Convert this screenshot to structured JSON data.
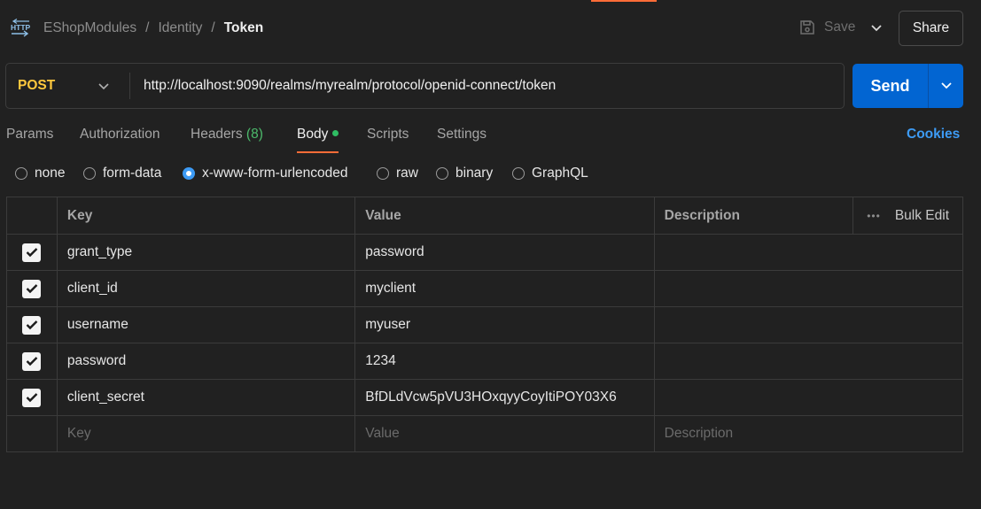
{
  "breadcrumb": {
    "workspace": "EShopModules",
    "folder": "Identity",
    "request": "Token",
    "separator": "/"
  },
  "header": {
    "save_label": "Save",
    "share_label": "Share"
  },
  "request": {
    "method": "POST",
    "url": "http://localhost:9090/realms/myrealm/protocol/openid-connect/token",
    "send_label": "Send"
  },
  "tabs": {
    "params": "Params",
    "authorization": "Authorization",
    "headers": "Headers",
    "headers_count": "(8)",
    "body": "Body",
    "scripts": "Scripts",
    "settings": "Settings",
    "cookies": "Cookies"
  },
  "body_types": {
    "options": [
      "none",
      "form-data",
      "x-www-form-urlencoded",
      "raw",
      "binary",
      "GraphQL"
    ],
    "selected": "x-www-form-urlencoded"
  },
  "table": {
    "headers": {
      "key": "Key",
      "value": "Value",
      "description": "Description",
      "bulk_edit": "Bulk Edit"
    },
    "rows": [
      {
        "key": "grant_type",
        "value": "password",
        "description": "",
        "checked": true
      },
      {
        "key": "client_id",
        "value": "myclient",
        "description": "",
        "checked": true
      },
      {
        "key": "username",
        "value": "myuser",
        "description": "",
        "checked": true
      },
      {
        "key": "password",
        "value": "1234",
        "description": "",
        "checked": true
      },
      {
        "key": "client_secret",
        "value": "BfDLdVcw5pVU3HOxqyyCoyItiPOY03X6",
        "description": "",
        "checked": true
      }
    ],
    "placeholders": {
      "key": "Key",
      "value": "Value",
      "description": "Description"
    }
  },
  "colors": {
    "accent": "#ff6c37",
    "send": "#0265d2",
    "method": "#ffc83d",
    "link": "#3d9bf5",
    "count": "#4cb96b"
  }
}
